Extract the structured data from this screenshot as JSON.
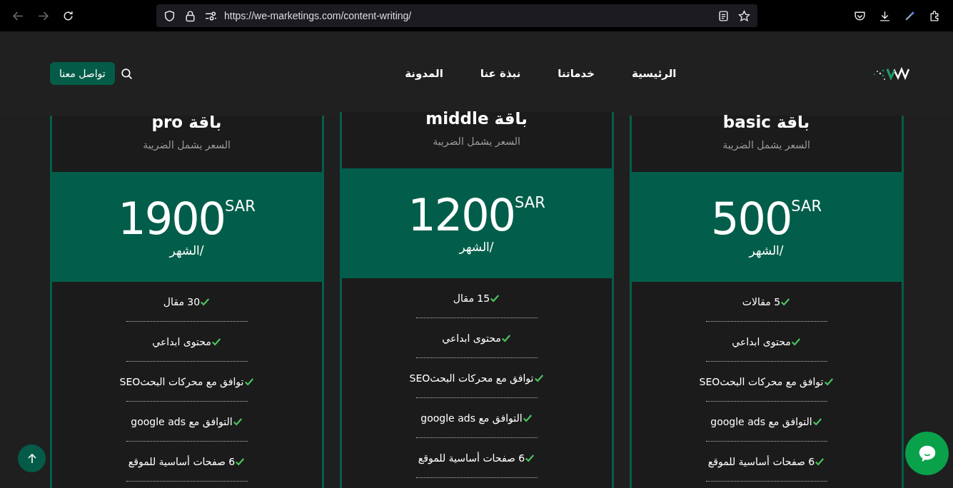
{
  "browser": {
    "url": "https://we-marketings.com/content-writing/"
  },
  "nav": {
    "items": [
      {
        "label": "الرئيسية"
      },
      {
        "label": "خدماتنا"
      },
      {
        "label": "نبذة عنا"
      },
      {
        "label": "المدونة"
      }
    ],
    "contact_button": "تواصل معنا"
  },
  "plans": [
    {
      "title": "باقة basic",
      "subtitle": "السعر يشمل الضريبة",
      "price": "500",
      "currency": "SAR",
      "period": "/الشهر",
      "raised": false,
      "features": [
        "5 مقالات",
        "محتوى ابداعي",
        "توافق مع محركات البحثSEO",
        "التوافق مع google ads",
        "6 صفحات أساسية للموقع"
      ]
    },
    {
      "title": "باقة middle",
      "subtitle": "السعر يشمل الضريبة",
      "price": "1200",
      "currency": "SAR",
      "period": "/الشهر",
      "raised": true,
      "features": [
        "15 مقال",
        "محتوى ابداعي",
        "توافق مع محركات البحثSEO",
        "التوافق مع google ads",
        "6 صفحات أساسية للموقع"
      ]
    },
    {
      "title": "باقة pro",
      "subtitle": "السعر يشمل الضريبة",
      "price": "1900",
      "currency": "SAR",
      "period": "/الشهر",
      "raised": false,
      "features": [
        "30 مقال",
        "محتوى ابداعي",
        "توافق مع محركات البحثSEO",
        "التوافق مع google ads",
        "6 صفحات أساسية للموقع"
      ]
    }
  ]
}
